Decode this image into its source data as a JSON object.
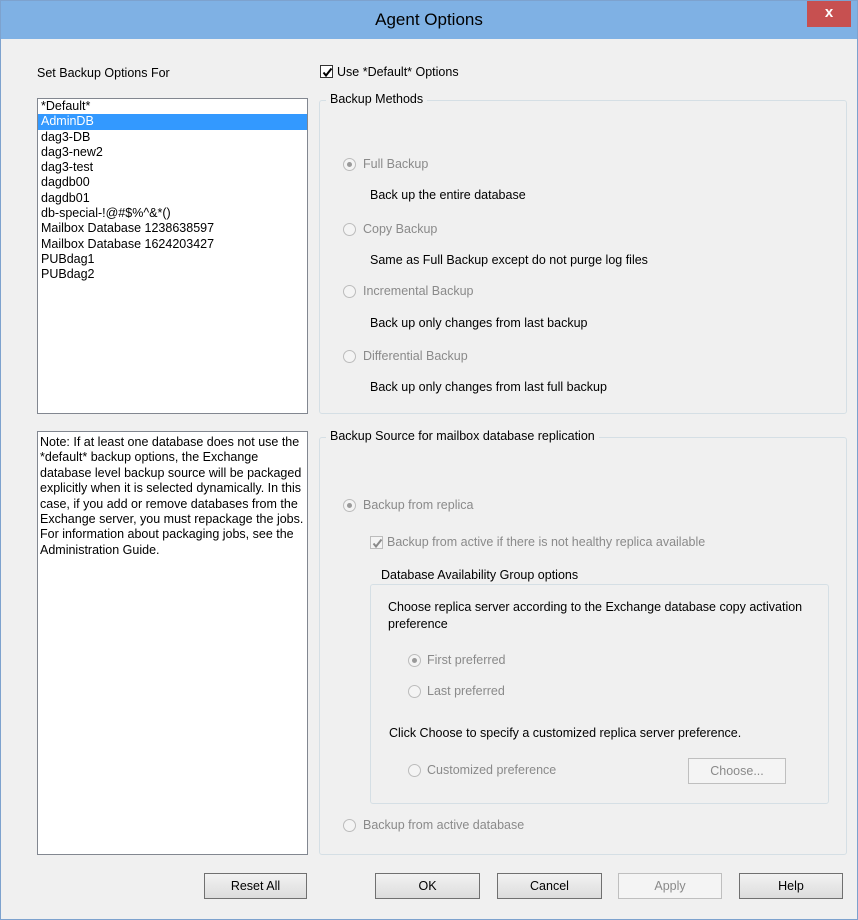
{
  "window": {
    "title": "Agent Options",
    "close_glyph": "x"
  },
  "left": {
    "set_options_label": "Set Backup Options For",
    "databases": [
      {
        "name": "*Default*",
        "selected": false
      },
      {
        "name": "AdminDB",
        "selected": true
      },
      {
        "name": "dag3-DB",
        "selected": false
      },
      {
        "name": "dag3-new2",
        "selected": false
      },
      {
        "name": "dag3-test",
        "selected": false
      },
      {
        "name": "dagdb00",
        "selected": false
      },
      {
        "name": "dagdb01",
        "selected": false
      },
      {
        "name": "db-special-!@#$%^&*()",
        "selected": false
      },
      {
        "name": "Mailbox Database 1238638597",
        "selected": false
      },
      {
        "name": "Mailbox Database 1624203427",
        "selected": false
      },
      {
        "name": "PUBdag1",
        "selected": false
      },
      {
        "name": "PUBdag2",
        "selected": false
      }
    ],
    "note": "Note: If at least one database does not use the *default* backup options, the Exchange database level backup source will be packaged explicitly when it is selected dynamically. In this case, if you add or remove databases from the Exchange server, you must repackage the jobs. For information about packaging jobs, see the Administration Guide.",
    "reset_all_label": "Reset All"
  },
  "use_default": {
    "label": "Use *Default* Options",
    "checked": true
  },
  "backup_methods": {
    "title": "Backup Methods",
    "options": [
      {
        "label": "Full Backup",
        "description": "Back up the entire database",
        "checked": true
      },
      {
        "label": "Copy Backup",
        "description": "Same as Full Backup except do not purge log files",
        "checked": false
      },
      {
        "label": "Incremental Backup",
        "description": "Back up only changes from last backup",
        "checked": false
      },
      {
        "label": "Differential Backup",
        "description": "Back up only changes from last full backup",
        "checked": false
      }
    ]
  },
  "backup_source": {
    "title": "Backup Source for mailbox database replication",
    "from_replica_label": "Backup from replica",
    "from_replica_checked": true,
    "fallback_active_label": "Backup from active if there is not healthy replica available",
    "fallback_active_checked": true,
    "dag": {
      "title": "Database Availability Group options",
      "choose_text": "Choose replica server according to the Exchange database copy activation preference",
      "first_preferred": "First preferred",
      "first_checked": true,
      "last_preferred": "Last preferred",
      "last_checked": false,
      "click_choose_text": "Click Choose to specify a customized replica server preference.",
      "customized_label": "Customized preference",
      "customized_checked": false,
      "choose_button": "Choose..."
    },
    "from_active_label": "Backup from active database",
    "from_active_checked": false
  },
  "buttons": {
    "ok": "OK",
    "cancel": "Cancel",
    "apply": "Apply",
    "help": "Help"
  }
}
